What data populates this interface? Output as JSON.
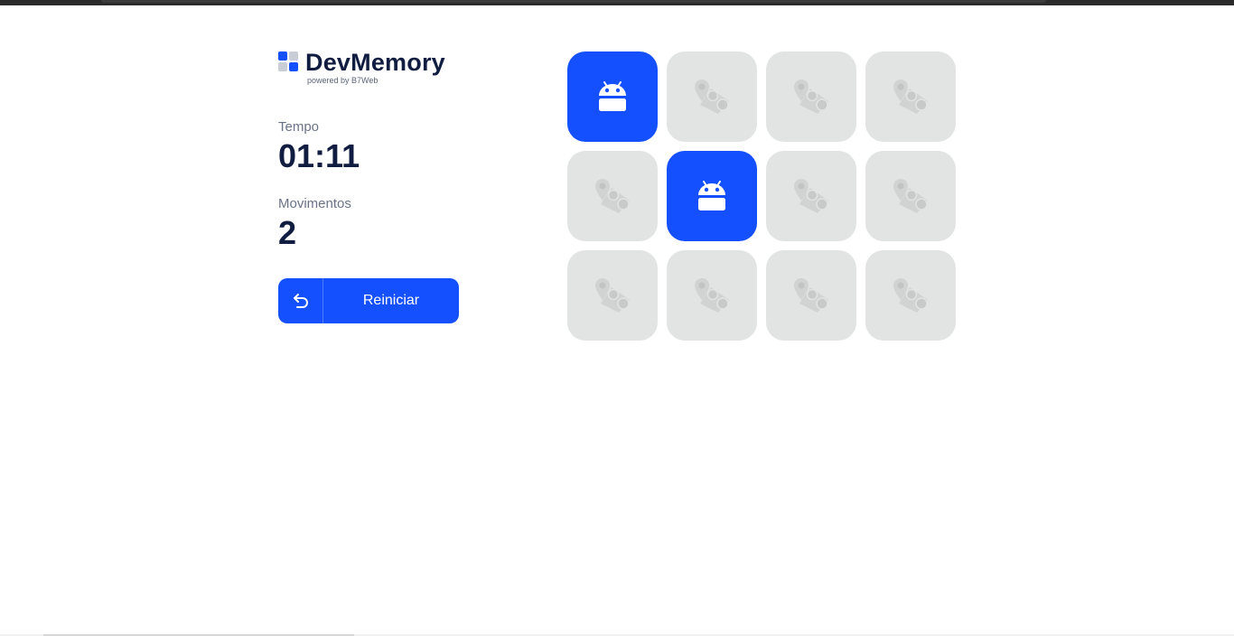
{
  "brand": {
    "title": "DevMemory",
    "subtitle": "powered by B7Web"
  },
  "stats": {
    "time_label": "Tempo",
    "time_value": "01:11",
    "moves_label": "Movimentos",
    "moves_value": "2"
  },
  "restart_button": {
    "label": "Reiniciar",
    "icon": "restart-arrow-icon"
  },
  "colors": {
    "accent": "#1550ff",
    "card_back": "#e2e3e3",
    "heading": "#101c40"
  },
  "board": {
    "columns": 4,
    "rows": 3,
    "cards": [
      {
        "state": "flipped",
        "icon": "android-icon"
      },
      {
        "state": "hidden",
        "icon": "card-back-icon"
      },
      {
        "state": "hidden",
        "icon": "card-back-icon"
      },
      {
        "state": "hidden",
        "icon": "card-back-icon"
      },
      {
        "state": "hidden",
        "icon": "card-back-icon"
      },
      {
        "state": "flipped",
        "icon": "android-icon"
      },
      {
        "state": "hidden",
        "icon": "card-back-icon"
      },
      {
        "state": "hidden",
        "icon": "card-back-icon"
      },
      {
        "state": "hidden",
        "icon": "card-back-icon"
      },
      {
        "state": "hidden",
        "icon": "card-back-icon"
      },
      {
        "state": "hidden",
        "icon": "card-back-icon"
      },
      {
        "state": "hidden",
        "icon": "card-back-icon"
      }
    ]
  }
}
